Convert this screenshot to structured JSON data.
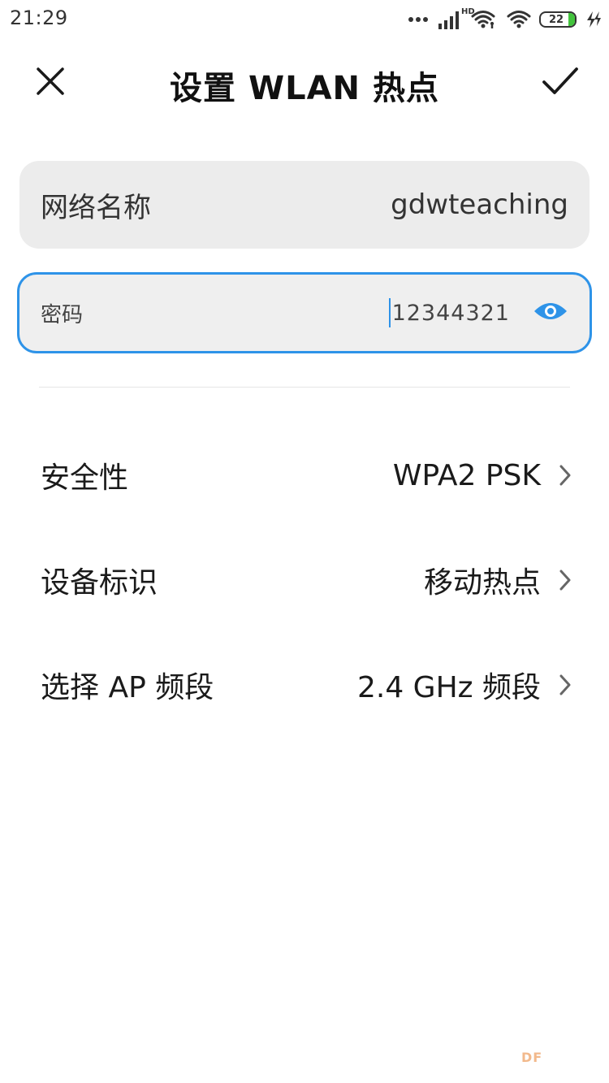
{
  "status_bar": {
    "time": "21:29",
    "hd_label": "HD",
    "battery_level": "22",
    "icons": [
      "more-dots-icon",
      "signal-icon",
      "wifi-link-icon",
      "wifi-icon",
      "battery-icon",
      "charging-icon"
    ],
    "battery_color": "#42c33c"
  },
  "header": {
    "title": "设置 WLAN 热点",
    "close_icon": "close-icon",
    "confirm_icon": "check-icon"
  },
  "fields": {
    "ssid": {
      "label": "网络名称",
      "value": "gdwteaching"
    },
    "password": {
      "label": "密码",
      "value": "12344321",
      "visibility_icon": "eye-icon",
      "focus_color": "#2e93e8"
    }
  },
  "settings": {
    "items": [
      {
        "label": "安全性",
        "value": "WPA2 PSK"
      },
      {
        "label": "设备标识",
        "value": "移动热点"
      },
      {
        "label": "选择 AP 频段",
        "value": "2.4 GHz 频段"
      }
    ]
  },
  "watermark": "DF"
}
